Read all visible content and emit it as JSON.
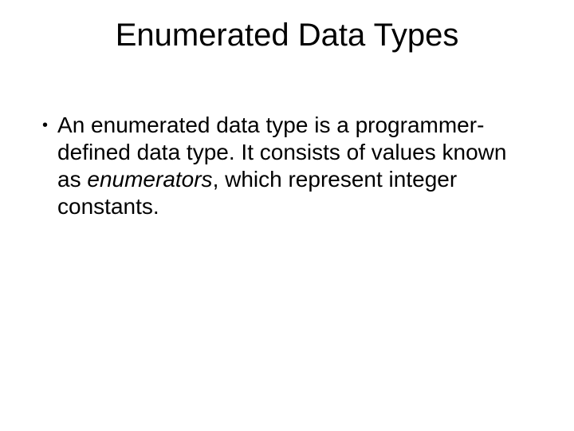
{
  "title": "Enumerated Data Types",
  "bullet": {
    "part1": "An enumerated data type is a programmer-defined data type. It consists of values known as ",
    "em": "enumerators",
    "part2": ", which represent integer constants."
  }
}
